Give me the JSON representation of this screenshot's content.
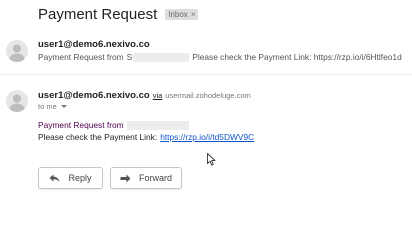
{
  "subject": {
    "title": "Payment Request",
    "label": "Inbox",
    "label_close": "×"
  },
  "message1": {
    "sender": "user1@demo6.nexivo.co",
    "snippet_prefix": "Payment Request from",
    "snippet_first_letter": "S",
    "snippet_suffix": "Please check the Payment Link: https://rzp.io/i/6Htlfeo1d"
  },
  "message2": {
    "sender": "user1@demo6.nexivo.co",
    "via_label": "via",
    "via_domain": "usermail.zohodeluge.com",
    "to_label": "to me",
    "body_line1": "Payment Request from",
    "body_line2_prefix": "Please check the Payment Link:",
    "payment_link": "https://rzp.io/i/td5DWV9C"
  },
  "actions": {
    "reply_label": "Reply",
    "forward_label": "Forward"
  },
  "icons": {
    "avatar": "person-avatar-icon",
    "reply": "reply-arrow-icon",
    "forward": "forward-arrow-icon",
    "cursor": "mouse-pointer-icon",
    "caret": "caret-down-icon"
  },
  "colors": {
    "link": "#1155cc",
    "quoted_text": "#500050",
    "label_bg": "#dddddd"
  }
}
